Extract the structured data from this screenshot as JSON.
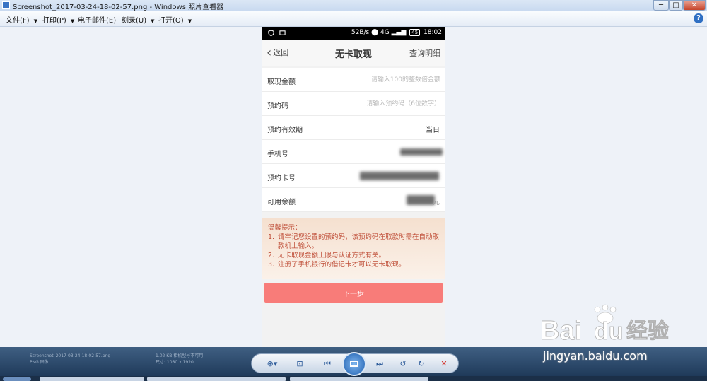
{
  "window": {
    "title": "Screenshot_2017-03-24-18-02-57.png - Windows 照片查看器",
    "minimize": "─",
    "maximize": "□",
    "close": "✕"
  },
  "menu": {
    "items": [
      "文件(F)",
      "打印(P)",
      "电子邮件(E)",
      "刻录(U)",
      "打开(O)"
    ],
    "help": "?"
  },
  "phone": {
    "status": {
      "speed": "52B/s",
      "network": "4G",
      "battery": "45",
      "time": "18:02"
    },
    "header": {
      "back": "返回",
      "title": "无卡取现",
      "query": "查询明细"
    },
    "form": {
      "amount_label": "取现金额",
      "amount_placeholder": "请输入100的整数倍金额",
      "code_label": "预约码",
      "code_placeholder": "请输入预约码（6位数字）",
      "validity_label": "预约有效期",
      "validity_value": "当日",
      "phone_label": "手机号",
      "card_label": "预约卡号",
      "balance_label": "可用余额",
      "balance_suffix": "元"
    },
    "tips": {
      "title": "温馨提示：",
      "items": [
        "请牢记您设置的预约码，该预约码在取款时需在自动取款机上输入。",
        "无卡取现金额上限与认证方式有关。",
        "注册了手机银行的借记卡才可以无卡取现。"
      ],
      "nums": [
        "1.",
        "2.",
        "3."
      ]
    },
    "next_button": "下一步"
  },
  "viewer": {
    "file_line1": "Screenshot_2017-03-24-18-02-57.png",
    "file_line2": "PNG 图像",
    "file_info_right1": "1.02 KB  相机型号不可用",
    "file_info_right2": "尺寸: 1080 x 1920"
  },
  "watermark": {
    "logo_text": "Bai",
    "logo_du": "du",
    "logo_cn": "经验",
    "url": "jingyan.baidu.com"
  }
}
